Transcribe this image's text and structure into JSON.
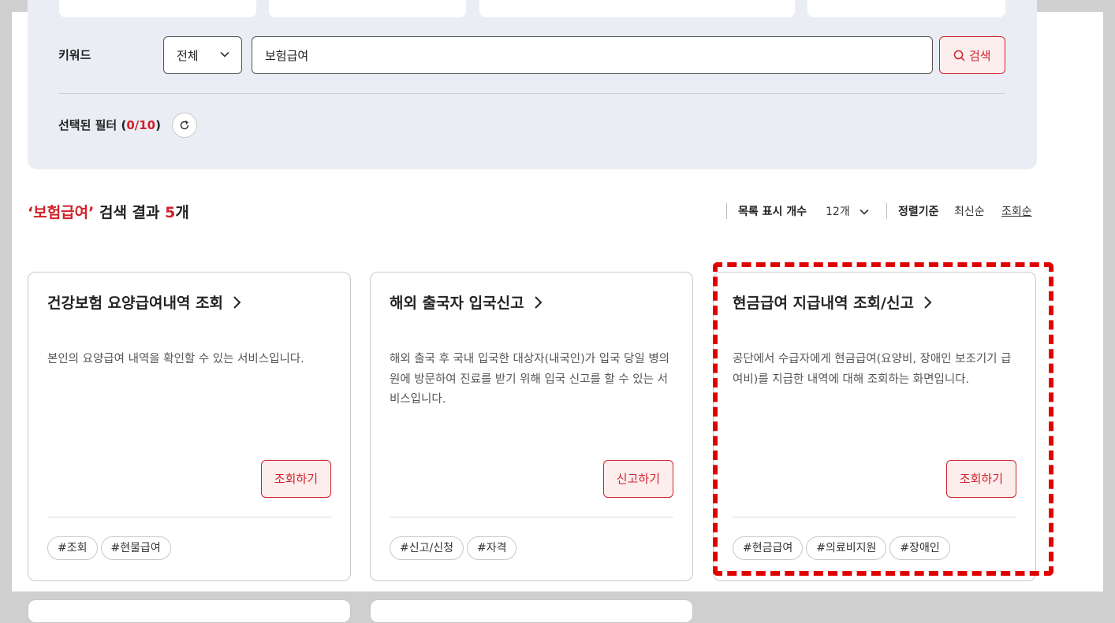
{
  "filter": {
    "keyword_label": "키워드",
    "scope_select_value": "전체",
    "search_value": "보험급여",
    "search_button_label": "검색",
    "selected_filter_label": "선택된 필터 (",
    "selected_filter_count": "0/10",
    "selected_filter_close": ")"
  },
  "results": {
    "quote_open": "‘",
    "keyword": "보험급여",
    "quote_close": "’",
    "text_middle": " 검색 결과 ",
    "count": "5",
    "count_unit": "개"
  },
  "list_controls": {
    "display_count_label": "목록 표시 개수",
    "display_count_value": "12개",
    "sort_label": "정렬기준",
    "sort_latest": "최신순",
    "sort_views": "조회순"
  },
  "cards": [
    {
      "title": "건강보험 요양급여내역 조회",
      "description": "본인의 요양급여 내역을 확인할 수 있는 서비스입니다.",
      "button_label": "조회하기",
      "tags": [
        "#조회",
        "#현물급여"
      ]
    },
    {
      "title": "해외 출국자 입국신고",
      "description": "해외 출국 후 국내 입국한 대상자(내국인)가 입국 당일 병의원에 방문하여 진료를 받기 위해 입국 신고를 할 수 있는 서비스입니다.",
      "button_label": "신고하기",
      "tags": [
        "#신고/신청",
        "#자격"
      ]
    },
    {
      "title": "현금급여 지급내역 조회/신고",
      "description": "공단에서 수급자에게 현금급여(요양비, 장애인 보조기기 급여비)를 지급한 내역에 대해 조회하는 화면입니다.",
      "button_label": "조회하기",
      "tags": [
        "#현금급여",
        "#의료비지원",
        "#장애인"
      ]
    }
  ],
  "colors": {
    "accent": "#d0222a",
    "panel_bg": "#eaeef4",
    "highlight": "#e10000"
  }
}
